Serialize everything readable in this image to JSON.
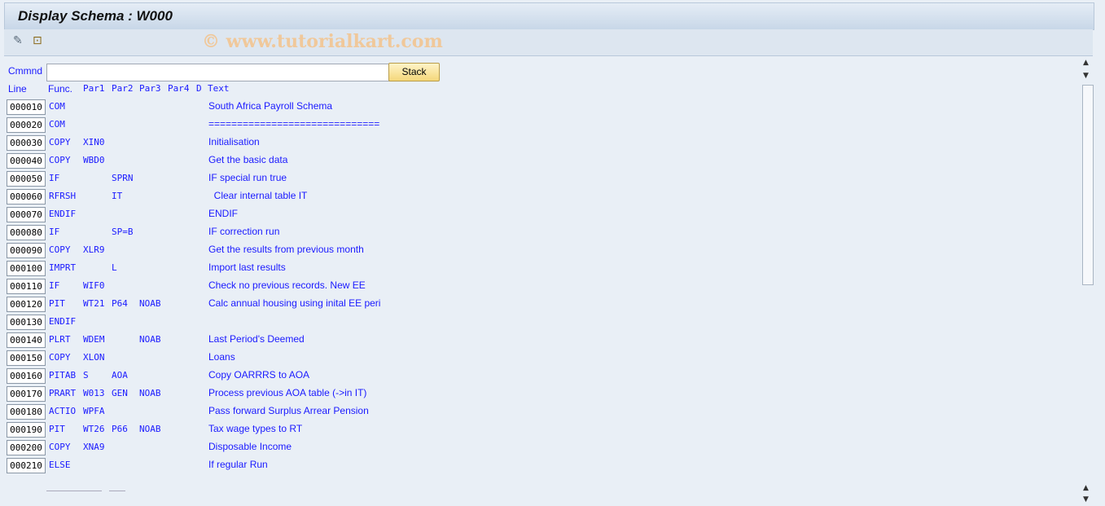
{
  "window": {
    "title": "Display Schema : W000"
  },
  "toolbar": {
    "icons": [
      "edit-icon",
      "hierarchy-icon"
    ],
    "watermark": "© www.tutorialkart.com"
  },
  "command": {
    "label": "Cmmnd",
    "value": "",
    "stack_label": "Stack"
  },
  "headers": {
    "line": "Line",
    "func": "Func.",
    "par1": "Par1",
    "par2": "Par2",
    "par3": "Par3",
    "par4": "Par4",
    "d": "D",
    "text": "Text"
  },
  "rows": [
    {
      "line": "000010",
      "func": "COM",
      "par1": "",
      "par2": "",
      "par3": "",
      "text": "South Africa Payroll Schema"
    },
    {
      "line": "000020",
      "func": "COM",
      "par1": "",
      "par2": "",
      "par3": "",
      "text": "=============================="
    },
    {
      "line": "000030",
      "func": "COPY",
      "par1": "XIN0",
      "par2": "",
      "par3": "",
      "text": "Initialisation"
    },
    {
      "line": "000040",
      "func": "COPY",
      "par1": "WBD0",
      "par2": "",
      "par3": "",
      "text": "Get the basic data"
    },
    {
      "line": "000050",
      "func": "IF",
      "par1": "",
      "par2": "SPRN",
      "par3": "",
      "text": "IF special run true"
    },
    {
      "line": "000060",
      "func": "RFRSH",
      "par1": "",
      "par2": "IT",
      "par3": "",
      "text": "  Clear internal table IT"
    },
    {
      "line": "000070",
      "func": "ENDIF",
      "par1": "",
      "par2": "",
      "par3": "",
      "text": "ENDIF"
    },
    {
      "line": "000080",
      "func": "IF",
      "par1": "",
      "par2": "SP=B",
      "par3": "",
      "text": "IF correction run"
    },
    {
      "line": "000090",
      "func": "COPY",
      "par1": "XLR9",
      "par2": "",
      "par3": "",
      "text": "Get the results from previous month"
    },
    {
      "line": "000100",
      "func": "IMPRT",
      "par1": "",
      "par2": "L",
      "par3": "",
      "text": "Import last results"
    },
    {
      "line": "000110",
      "func": "IF",
      "par1": "WIF0",
      "par2": "",
      "par3": "",
      "text": "Check no previous records. New EE"
    },
    {
      "line": "000120",
      "func": "PIT",
      "par1": "WT21",
      "par2": "P64",
      "par3": "NOAB",
      "text": "Calc annual housing using inital EE peri"
    },
    {
      "line": "000130",
      "func": "ENDIF",
      "par1": "",
      "par2": "",
      "par3": "",
      "text": ""
    },
    {
      "line": "000140",
      "func": "PLRT",
      "par1": "WDEM",
      "par2": "",
      "par3": "NOAB",
      "text": "Last Period's Deemed"
    },
    {
      "line": "000150",
      "func": "COPY",
      "par1": "XLON",
      "par2": "",
      "par3": "",
      "text": "Loans"
    },
    {
      "line": "000160",
      "func": "PITAB",
      "par1": "S",
      "par2": "AOA",
      "par3": "",
      "text": "Copy OARRRS to AOA"
    },
    {
      "line": "000170",
      "func": "PRART",
      "par1": "W013",
      "par2": "GEN",
      "par3": "NOAB",
      "text": "Process previous AOA table (->in IT)"
    },
    {
      "line": "000180",
      "func": "ACTIO",
      "par1": "WPFA",
      "par2": "",
      "par3": "",
      "text": "Pass forward Surplus Arrear Pension"
    },
    {
      "line": "000190",
      "func": "PIT",
      "par1": "WT26",
      "par2": "P66",
      "par3": "NOAB",
      "text": "Tax wage types to RT"
    },
    {
      "line": "000200",
      "func": "COPY",
      "par1": "XNA9",
      "par2": "",
      "par3": "",
      "text": "Disposable Income"
    },
    {
      "line": "000210",
      "func": "ELSE",
      "par1": "",
      "par2": "",
      "par3": "",
      "text": "If regular Run"
    }
  ]
}
